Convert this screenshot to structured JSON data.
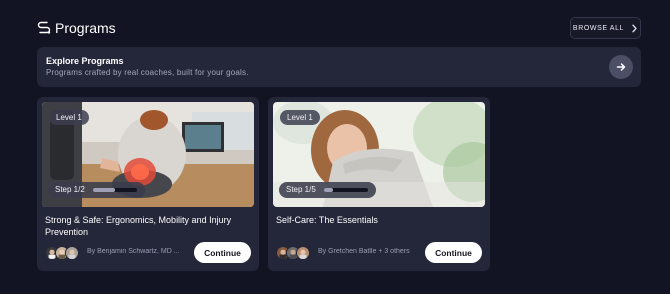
{
  "header": {
    "title": "Programs",
    "icon": "programs-icon",
    "browse_label": "BROWSE ALL"
  },
  "explore": {
    "title": "Explore Programs",
    "subtitle": "Programs crafted by real coaches, built for your goals."
  },
  "programs": [
    {
      "level": "Level 1",
      "step": "Step 1/2",
      "progress": 0.5,
      "title": "Strong & Safe: Ergonomics, Mobility and Injury Prevention",
      "byline": "By Benjamin Schwartz, MD ...",
      "continue_label": "Continue"
    },
    {
      "level": "Level 1",
      "step": "Step 1/5",
      "progress": 0.2,
      "title": "Self-Care: The Essentials",
      "byline": "By Gretchen Batlle + 3 others",
      "continue_label": "Continue"
    }
  ],
  "colors": {
    "background": "#131423",
    "card": "#242639",
    "button": "#ffffff",
    "muted_text": "#9a9db1"
  }
}
